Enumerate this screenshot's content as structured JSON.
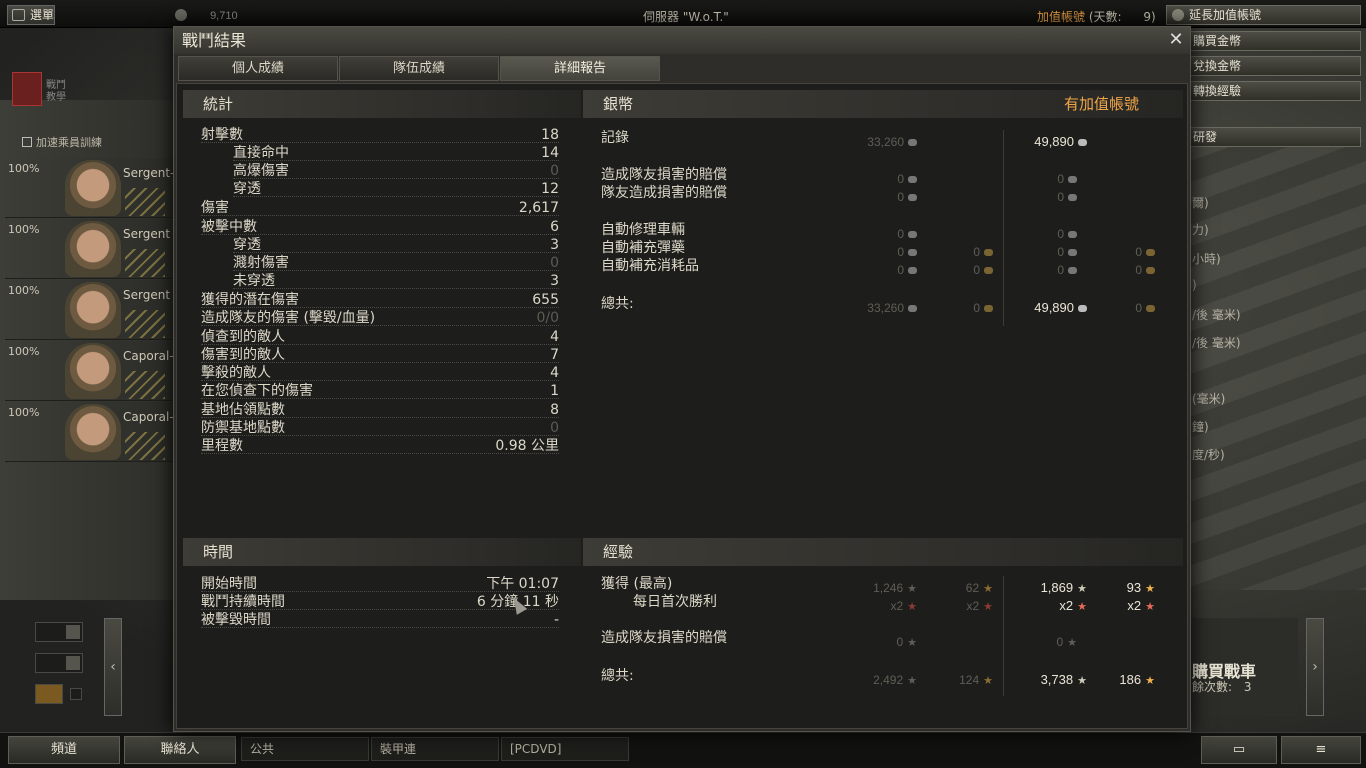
{
  "topbar": {
    "menu_label": "選單",
    "player_gold": "9,710",
    "server": "伺服器 \"W.o.T.\"",
    "premium_label": "加值帳號",
    "premium_days_label": "(天數:",
    "premium_days": "9)",
    "extend_premium": "延長加值帳號"
  },
  "side_menu": {
    "buy_gold": "購買金幣",
    "exchange_gold": "兌換金幣",
    "convert_exp": "轉換經驗",
    "research": "研發",
    "stats_fragments": [
      "爾)",
      "力)",
      "小時)",
      ")",
      "/後 毫米)",
      "/後 毫米)",
      "(毫米)",
      "鐘)",
      "度/秒)"
    ]
  },
  "crew": {
    "header": "加速乘員訓練",
    "members": [
      {
        "pct": "100%",
        "rank": "Sergent-"
      },
      {
        "pct": "100%",
        "rank": "Sergent"
      },
      {
        "pct": "100%",
        "rank": "Sergent"
      },
      {
        "pct": "100%",
        "rank": "Caporal-"
      },
      {
        "pct": "100%",
        "rank": "Caporal-"
      }
    ],
    "school_label": "戰鬥\n教學"
  },
  "buy_tank": {
    "title": "購買戰車",
    "slots_label": "餘次數:",
    "slots": "3"
  },
  "bottombar": {
    "channels_btn": "頻道",
    "contacts_btn": "聯絡人",
    "tabs": [
      "公共",
      "裝甲連",
      "[PCDVD]"
    ]
  },
  "dialog": {
    "title": "戰鬥結果",
    "tabs": [
      "個人成績",
      "隊伍成績",
      "詳細報告"
    ],
    "active_tab": 2,
    "stats": {
      "title": "統計",
      "rows": [
        {
          "label": "射擊數",
          "value": "18",
          "indent": false,
          "dim": false
        },
        {
          "label": "直接命中",
          "value": "14",
          "indent": true,
          "dim": false
        },
        {
          "label": "高爆傷害",
          "value": "0",
          "indent": true,
          "dim": true
        },
        {
          "label": "穿透",
          "value": "12",
          "indent": true,
          "dim": false
        },
        {
          "label": "傷害",
          "value": "2,617",
          "indent": false,
          "dim": false
        },
        {
          "label": "被擊中數",
          "value": "6",
          "indent": false,
          "dim": false
        },
        {
          "label": "穿透",
          "value": "3",
          "indent": true,
          "dim": false
        },
        {
          "label": "濺射傷害",
          "value": "0",
          "indent": true,
          "dim": true
        },
        {
          "label": "未穿透",
          "value": "3",
          "indent": true,
          "dim": false
        },
        {
          "label": "獲得的潛在傷害",
          "value": "655",
          "indent": false,
          "dim": false
        },
        {
          "label": "造成隊友的傷害 (擊毀/血量)",
          "value": "0/0",
          "indent": false,
          "dim": true
        },
        {
          "label": "偵查到的敵人",
          "value": "4",
          "indent": false,
          "dim": false
        },
        {
          "label": "傷害到的敵人",
          "value": "7",
          "indent": false,
          "dim": false
        },
        {
          "label": "擊殺的敵人",
          "value": "4",
          "indent": false,
          "dim": false
        },
        {
          "label": "在您偵查下的傷害",
          "value": "1",
          "indent": false,
          "dim": false
        },
        {
          "label": "基地佔領點數",
          "value": "8",
          "indent": false,
          "dim": false
        },
        {
          "label": "防禦基地點數",
          "value": "0",
          "indent": false,
          "dim": true
        },
        {
          "label": "里程數",
          "value": "0.98 公里",
          "indent": false,
          "dim": false
        }
      ]
    },
    "credits": {
      "title": "銀幣",
      "premium_header": "有加值帳號",
      "rows": [
        {
          "label": "記錄",
          "std": "33,260",
          "std_gold": "",
          "prem": "49,890",
          "prem_gold": ""
        },
        {
          "label": "造成隊友損害的賠償",
          "std": "0",
          "std_gold": "",
          "prem": "0",
          "prem_gold": ""
        },
        {
          "label": "隊友造成損害的賠償",
          "std": "0",
          "std_gold": "",
          "prem": "0",
          "prem_gold": ""
        },
        {
          "label": "自動修理車輛",
          "std": "0",
          "std_gold": "",
          "prem": "0",
          "prem_gold": ""
        },
        {
          "label": "自動補充彈藥",
          "std": "0",
          "std_gold": "0",
          "prem": "0",
          "prem_gold": "0"
        },
        {
          "label": "自動補充消耗品",
          "std": "0",
          "std_gold": "0",
          "prem": "0",
          "prem_gold": "0"
        },
        {
          "label": "總共:",
          "std": "33,260",
          "std_gold": "0",
          "prem": "49,890",
          "prem_gold": "0"
        }
      ]
    },
    "time": {
      "title": "時間",
      "rows": [
        {
          "label": "開始時間",
          "value": "下午 01:07"
        },
        {
          "label": "戰鬥持續時間",
          "value": "6 分鐘 11 秒"
        },
        {
          "label": "被擊毀時間",
          "value": "-"
        }
      ]
    },
    "experience": {
      "title": "經驗",
      "earned_label": "獲得 (最高)",
      "daily_label": "每日首次勝利",
      "team_dmg_label": "造成隊友損害的賠償",
      "total_label": "總共:",
      "earned": {
        "std": "1,246",
        "std_free": "62",
        "prem": "1,869",
        "prem_free": "93"
      },
      "daily": {
        "std": "x2",
        "std_free": "x2",
        "prem": "x2",
        "prem_free": "x2"
      },
      "team_dmg": {
        "std": "0",
        "prem": "0"
      },
      "total": {
        "std": "2,492",
        "std_free": "124",
        "prem": "3,738",
        "prem_free": "186"
      }
    }
  }
}
